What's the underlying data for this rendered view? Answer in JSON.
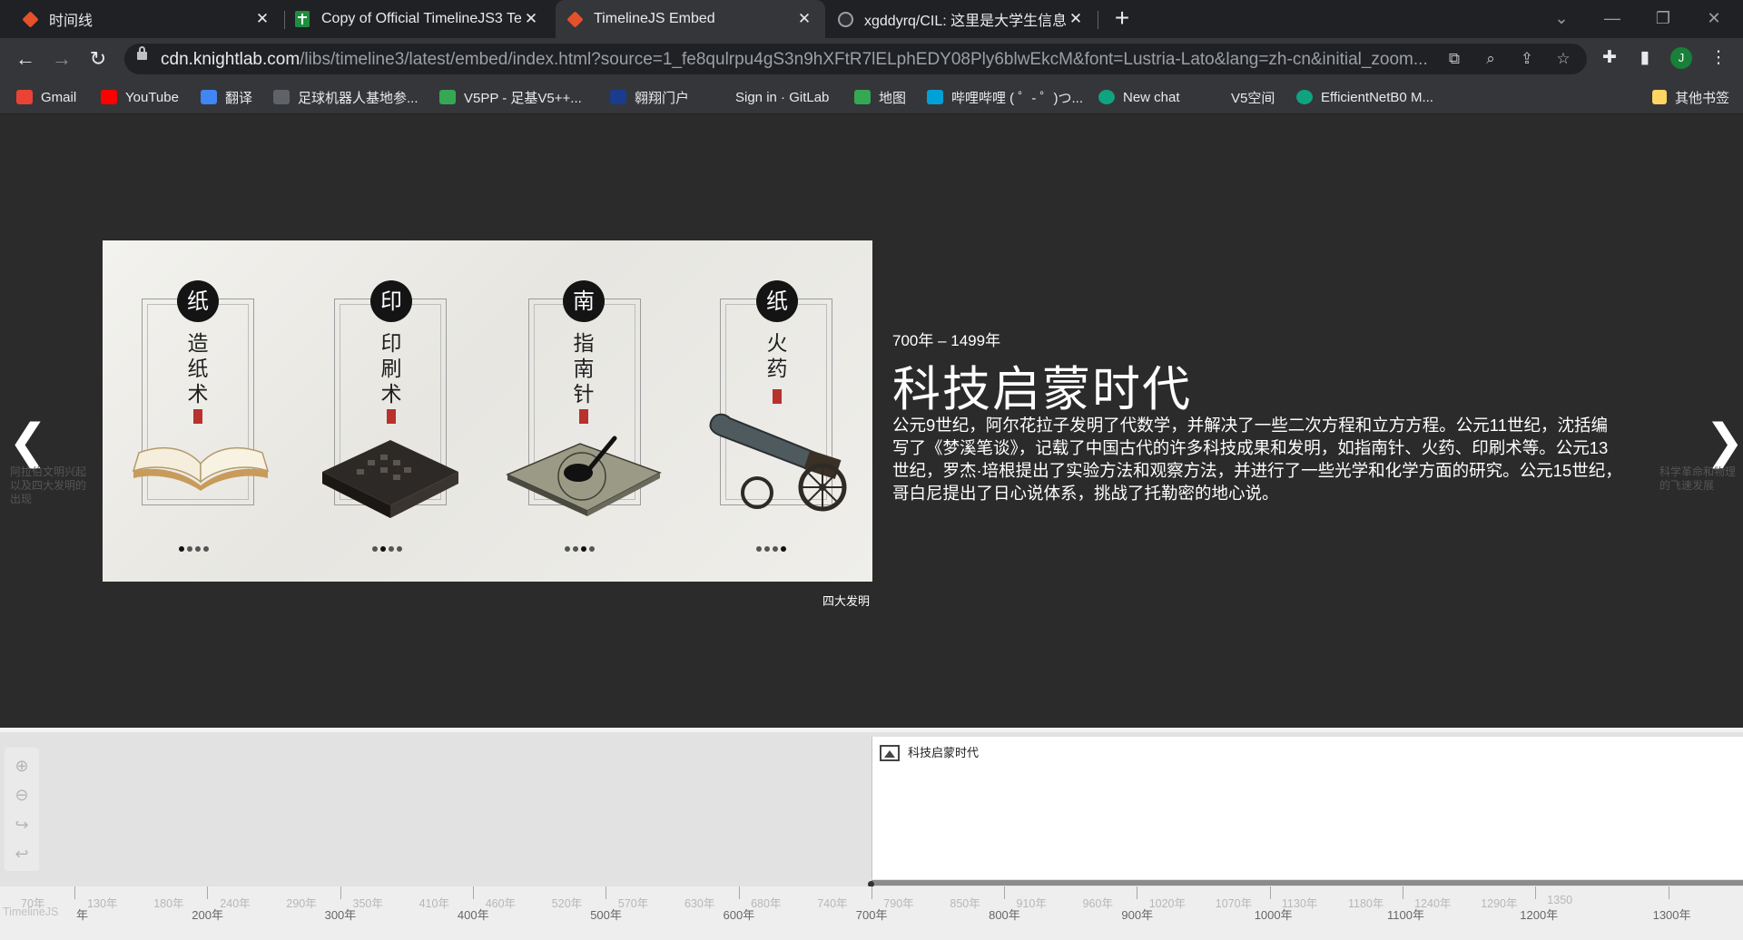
{
  "tabs": [
    {
      "title": "时间线",
      "icon": "knightlab-diamond-icon",
      "active": false
    },
    {
      "title": "Copy of Official TimelineJS3 Te",
      "icon": "google-sheets-icon",
      "active": false
    },
    {
      "title": "TimelineJS Embed",
      "icon": "knightlab-diamond-icon",
      "active": true
    },
    {
      "title": "xgddyrq/CIL: 这里是大学生信息",
      "icon": "github-icon",
      "active": false
    }
  ],
  "address": {
    "host": "cdn.knightlab.com",
    "path": "/libs/timeline3/latest/embed/index.html?source=1_fe8qulrpu4gS3n9hXFtR7lELphEDY08Ply6blwEkcM&font=Lustria-Lato&lang=zh-cn&initial_zoom..."
  },
  "profile": {
    "initial": "J"
  },
  "bookmarks": [
    {
      "label": "Gmail",
      "color": "#ea4335"
    },
    {
      "label": "YouTube",
      "color": "#ff0000"
    },
    {
      "label": "翻译",
      "color": "#4285f4"
    },
    {
      "label": "足球机器人基地参...",
      "color": "#5f6368"
    },
    {
      "label": "V5PP - 足基V5++...",
      "color": "#34a853"
    },
    {
      "label": "翱翔门户",
      "color": "#1a3c8f"
    },
    {
      "label": "Sign in · GitLab",
      "color": "#35363a"
    },
    {
      "label": "地图",
      "color": "#34a853"
    },
    {
      "label": "哔哩哔哩 ( ゜- ゜)つ...",
      "color": "#00a1d6"
    },
    {
      "label": "New chat",
      "color": "#10a37f"
    },
    {
      "label": "V5空间",
      "color": "#35363a"
    },
    {
      "label": "EfficientNetB0 M...",
      "color": "#10a37f"
    }
  ],
  "bookmarks_other": "其他书签",
  "slide": {
    "date": "700年 – 1499年",
    "headline": "科技启蒙时代",
    "body": "公元9世纪，阿尔花拉子发明了代数学，并解决了一些二次方程和立方方程。公元11世纪，沈括编写了《梦溪笔谈》，记载了中国古代的许多科技成果和发明，如指南针、火药、印刷术等。公元13世纪，罗杰·培根提出了实验方法和观察方法，并进行了一些光学和化学方面的研究。公元15世纪，哥白尼提出了日心说体系，挑战了托勒密的地心说。",
    "caption": "四大发明",
    "prev_title": "阿拉伯文明兴起以及四大发明的出现",
    "next_title": "科学革命和物理的飞速发展"
  },
  "hero": {
    "panels": [
      {
        "circle": "纸",
        "text": "造纸术"
      },
      {
        "circle": "印",
        "text": "印刷术"
      },
      {
        "circle": "南",
        "text": "指南针"
      },
      {
        "circle": "纸",
        "text": "火药"
      }
    ]
  },
  "nav": {
    "marker_title": "科技启蒙时代",
    "brand": "TimelineJS",
    "minor_ticks": [
      "70年",
      "130年",
      "180年",
      "240年",
      "290年",
      "350年",
      "410年",
      "460年",
      "520年",
      "570年",
      "630年",
      "680年",
      "740年",
      "790年",
      "850年",
      "910年",
      "960年",
      "1020年",
      "1070年",
      "1130年",
      "1180年",
      "1240年",
      "1290年",
      "1350"
    ],
    "major_ticks": [
      "年",
      "200年",
      "300年",
      "400年",
      "500年",
      "600年",
      "700年",
      "800年",
      "900年",
      "1000年",
      "1100年",
      "1200年",
      "1300年"
    ]
  }
}
